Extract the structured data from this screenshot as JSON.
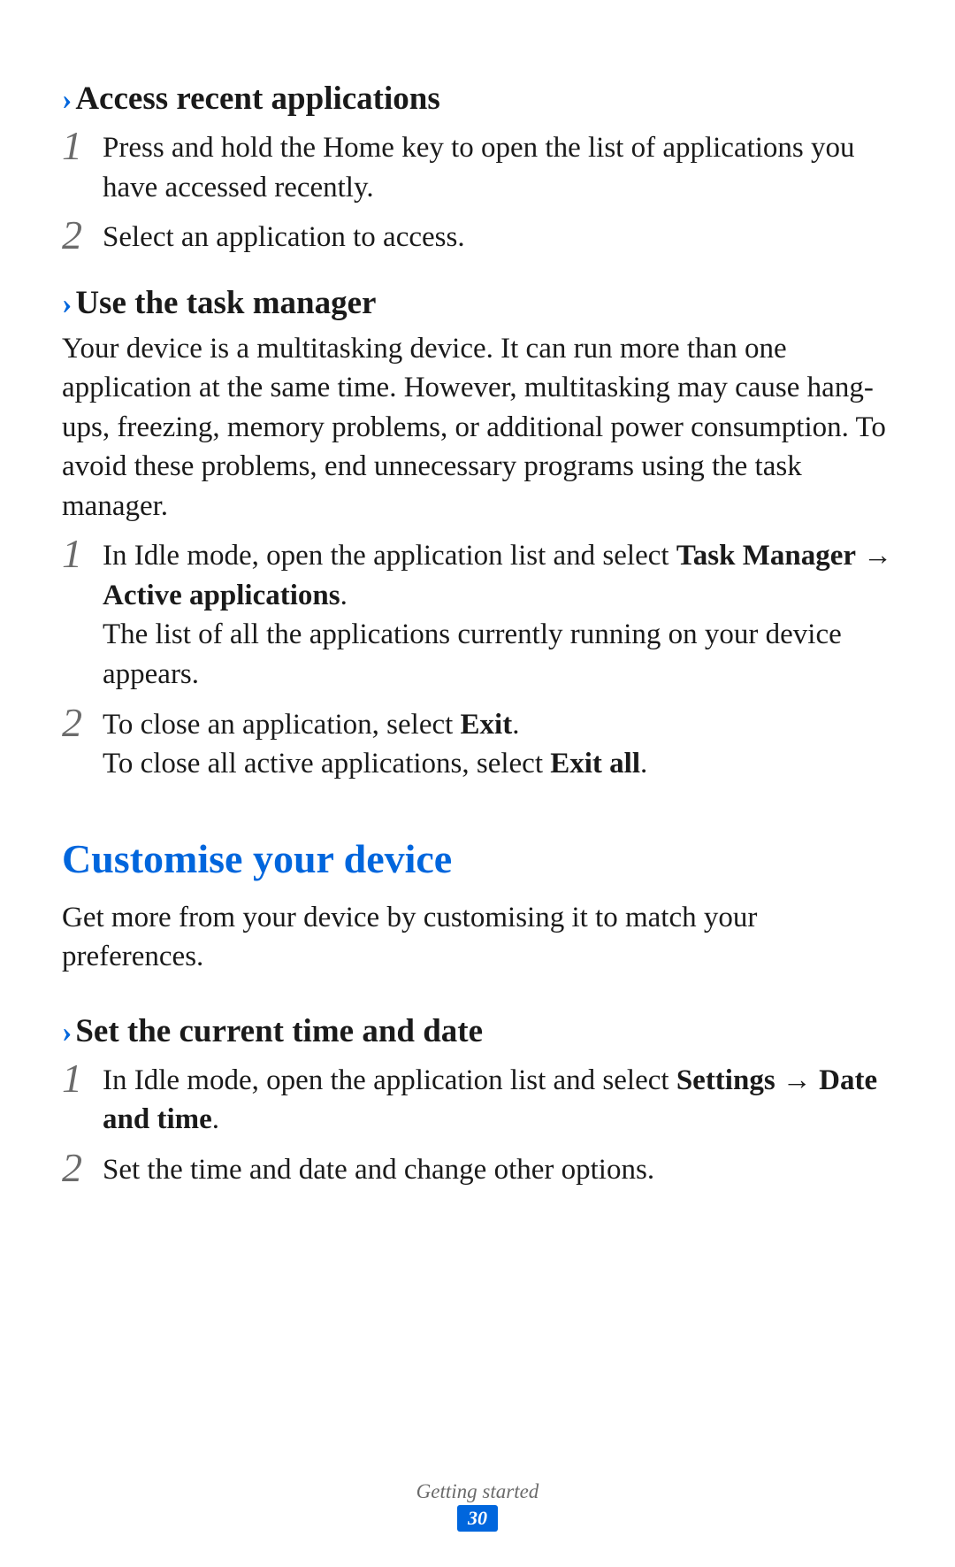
{
  "section1": {
    "heading": "Access recent applications",
    "step1": "Press and hold the Home key to open the list of applications you have accessed recently.",
    "step2": "Select an application to access."
  },
  "section2": {
    "heading": "Use the task manager",
    "intro": "Your device is a multitasking device. It can run more than one application at the same time. However, multitasking may cause hang-ups, freezing, memory problems, or additional power consumption. To avoid these problems, end unnecessary programs using the task manager.",
    "step1_pre": "In Idle mode, open the application list and select ",
    "step1_bold1": "Task Manager",
    "step1_arrow": " → ",
    "step1_bold2": "Active applications",
    "step1_dot": ".",
    "step1_after": "The list of all the applications currently running on your device appears.",
    "step2_pre": "To close an application, select ",
    "step2_bold": "Exit",
    "step2_dot": ".",
    "step2_line2_pre": "To close all active applications, select ",
    "step2_line2_bold": "Exit all",
    "step2_line2_dot": "."
  },
  "section3": {
    "title": "Customise your device",
    "intro": "Get more from your device by customising it to match your preferences.",
    "sub_heading": "Set the current time and date",
    "step1_pre": "In Idle mode, open the application list and select ",
    "step1_bold1": "Settings",
    "step1_arrow": " → ",
    "step1_bold2": "Date and time",
    "step1_dot": ".",
    "step2": "Set the time and date and change other options."
  },
  "footer": {
    "section": "Getting started",
    "page": "30"
  },
  "numbers": {
    "one": "1",
    "two": "2"
  },
  "chevron": "›"
}
